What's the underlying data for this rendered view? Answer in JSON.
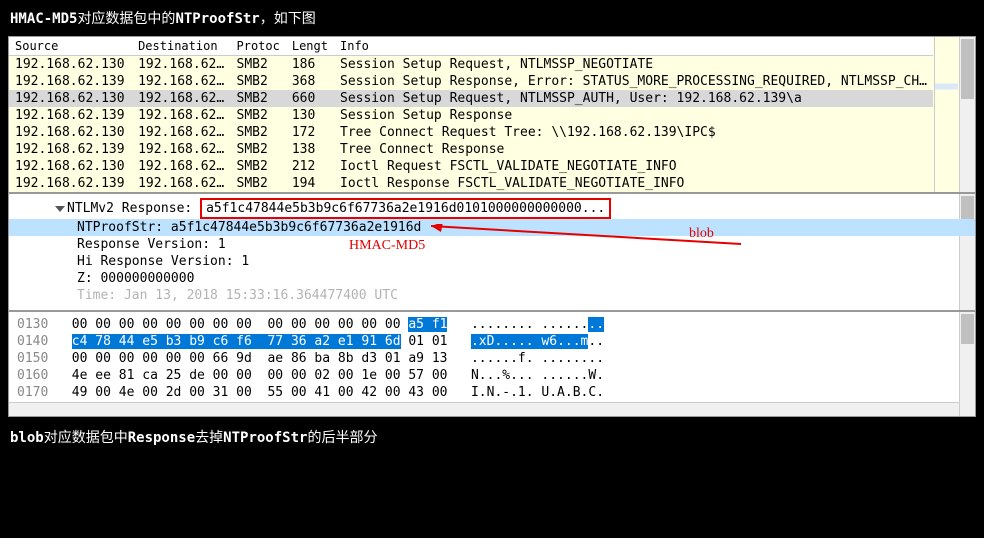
{
  "caption_top_pre": "HMAC-MD5",
  "caption_top_mid": "对应数据包中的",
  "caption_top_b2": "NTProofStr",
  "caption_top_end": "，如下图",
  "headers": {
    "src": "Source",
    "dst": "Destination",
    "proto": "Protoc",
    "len": "Lengt",
    "info": "Info"
  },
  "packets": [
    {
      "src": "192.168.62.130",
      "dst": "192.168.62…",
      "proto": "SMB2",
      "len": "186",
      "info": "Session Setup Request, NTLMSSP_NEGOTIATE"
    },
    {
      "src": "192.168.62.139",
      "dst": "192.168.62…",
      "proto": "SMB2",
      "len": "368",
      "info": "Session Setup Response, Error: STATUS_MORE_PROCESSING_REQUIRED, NTLMSSP_CH…"
    },
    {
      "src": "192.168.62.130",
      "dst": "192.168.62…",
      "proto": "SMB2",
      "len": "660",
      "info": "Session Setup Request, NTLMSSP_AUTH, User: 192.168.62.139\\a",
      "sel": true
    },
    {
      "src": "192.168.62.139",
      "dst": "192.168.62…",
      "proto": "SMB2",
      "len": "130",
      "info": "Session Setup Response"
    },
    {
      "src": "192.168.62.130",
      "dst": "192.168.62…",
      "proto": "SMB2",
      "len": "172",
      "info": "Tree Connect Request Tree: \\\\192.168.62.139\\IPC$"
    },
    {
      "src": "192.168.62.139",
      "dst": "192.168.62…",
      "proto": "SMB2",
      "len": "138",
      "info": "Tree Connect Response"
    },
    {
      "src": "192.168.62.130",
      "dst": "192.168.62…",
      "proto": "SMB2",
      "len": "212",
      "info": "Ioctl Request FSCTL_VALIDATE_NEGOTIATE_INFO"
    },
    {
      "src": "192.168.62.139",
      "dst": "192.168.62…",
      "proto": "SMB2",
      "len": "194",
      "info": "Ioctl Response FSCTL_VALIDATE_NEGOTIATE_INFO"
    }
  ],
  "details": {
    "response_label": "NTLMv2 Response: ",
    "response_value": "a5f1c47844e5b3b9c6f67736a2e1916d0101000000000000...",
    "ntproof": "NTProofStr: a5f1c47844e5b3b9c6f67736a2e1916d",
    "rv": "Response Version: 1",
    "hrv": "Hi Response Version: 1",
    "z": "Z: 000000000000",
    "time_partial": "Time: Jan 13, 2018 15:33:16.364477400 UTC"
  },
  "annot": {
    "hmac": "HMAC-MD5",
    "blob": "blob"
  },
  "hex": {
    "l0130": {
      "off": "0130",
      "pre": "00 00 00 00 00 00 00 00  00 00 00 00 00 00 ",
      "sel": "a5 f1",
      "asc_pre": "........ ......",
      "asc_sel": ".."
    },
    "l0140": {
      "off": "0140",
      "sel": "c4 78 44 e5 b3 b9 c6 f6  77 36 a2 e1 91 6d",
      "post": " 01 01",
      "asc_sel": ".xD..... w6...m",
      "asc_post": ".."
    },
    "l0150": {
      "off": "0150",
      "txt": "00 00 00 00 00 00 66 9d  ae 86 ba 8b d3 01 a9 13",
      "asc": "......f. ........"
    },
    "l0160": {
      "off": "0160",
      "txt": "4e ee 81 ca 25 de 00 00  00 00 02 00 1e 00 57 00",
      "asc": "N...%... ......W."
    },
    "l0170": {
      "off": "0170",
      "txt": "49 00 4e 00 2d 00 31 00  55 00 41 00 42 00 43 00",
      "asc": "I.N.-.1. U.A.B.C."
    }
  },
  "caption_bottom_b1": "blob",
  "caption_bottom_mid1": "对应数据包中",
  "caption_bottom_b2": "Response",
  "caption_bottom_mid2": "去掉",
  "caption_bottom_b3": "NTProofStr",
  "caption_bottom_end": "的后半部分"
}
